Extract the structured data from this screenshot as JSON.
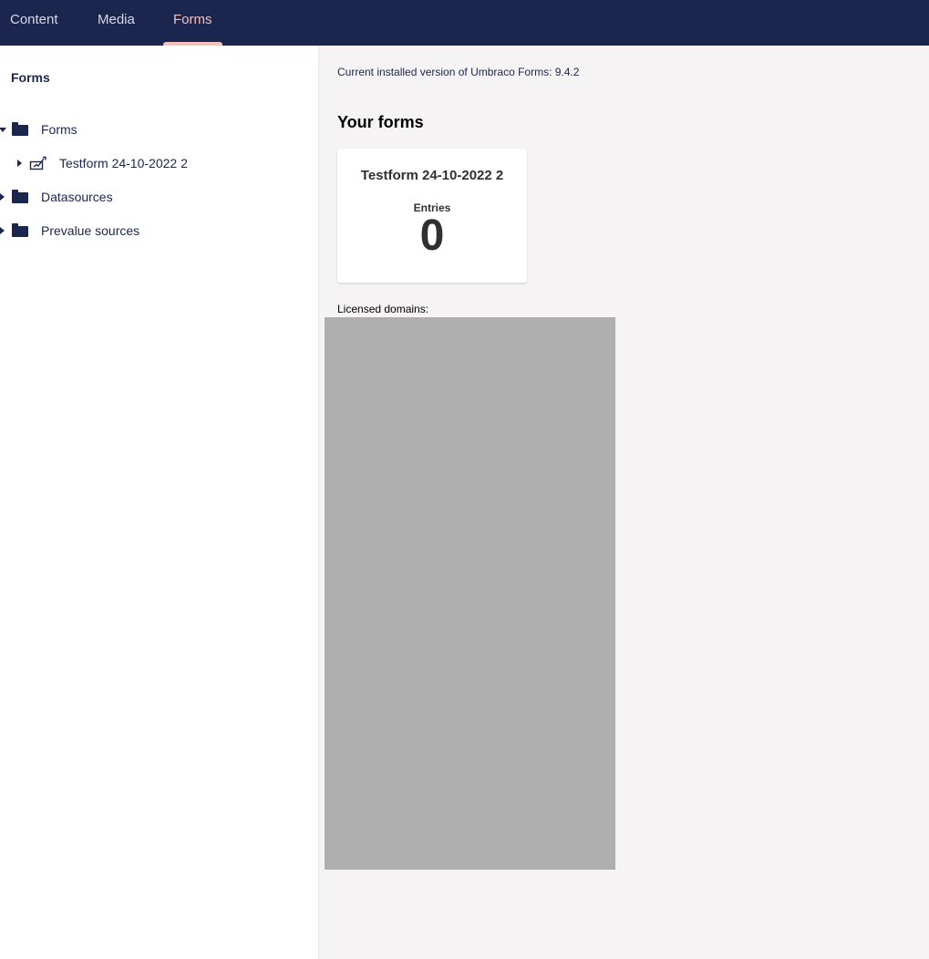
{
  "nav": {
    "tabs": [
      {
        "label": "Content",
        "active": false
      },
      {
        "label": "Media",
        "active": false
      },
      {
        "label": "Forms",
        "active": true
      }
    ]
  },
  "sidebar": {
    "title": "Forms",
    "tree": [
      {
        "label": "Forms",
        "icon": "folder-icon",
        "expanded": true
      },
      {
        "label": "Testform 24-10-2022 2",
        "icon": "form-icon",
        "expanded": false
      },
      {
        "label": "Datasources",
        "icon": "folder-icon",
        "expanded": false
      },
      {
        "label": "Prevalue sources",
        "icon": "folder-icon",
        "expanded": false
      }
    ]
  },
  "main": {
    "version_text": "Current installed version of Umbraco Forms: 9.4.2",
    "your_forms_title": "Your forms",
    "forms": [
      {
        "name": "Testform 24-10-2022 2",
        "entries_label": "Entries",
        "entries_count": "0"
      }
    ],
    "licensed_domains_label": "Licensed domains:"
  },
  "colors": {
    "header_bg": "#1b264f",
    "active_tab": "#f5c1bc",
    "main_bg": "#f5f3f4",
    "redacted": "#afafaf"
  }
}
